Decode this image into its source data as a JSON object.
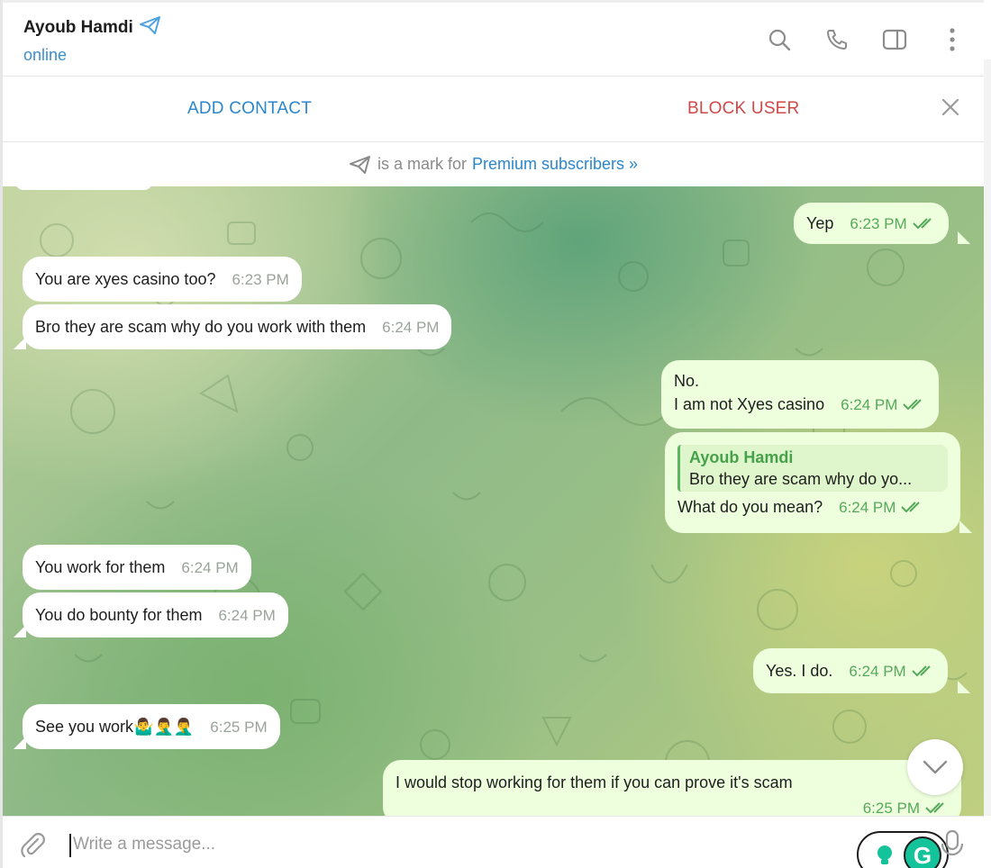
{
  "header": {
    "contact_name": "Ayoub Hamdi",
    "status": "online"
  },
  "contact_bar": {
    "add_label": "ADD CONTACT",
    "block_label": "BLOCK USER"
  },
  "premium": {
    "text": "is a mark for",
    "link": "Premium subscribers »"
  },
  "messages": [
    {
      "direction": "out",
      "text": "Yep",
      "time": "6:23 PM"
    },
    {
      "direction": "in",
      "text": "You are xyes casino too?",
      "time": "6:23 PM"
    },
    {
      "direction": "in",
      "text": "Bro they are scam why do you work with them",
      "time": "6:24 PM"
    },
    {
      "direction": "out",
      "lines": [
        "No.",
        "I am not Xyes casino"
      ],
      "time": "6:24 PM"
    },
    {
      "direction": "out",
      "reply_name": "Ayoub Hamdi",
      "reply_text": "Bro they are scam why do yo...",
      "text": "What do you mean?",
      "time": "6:24 PM"
    },
    {
      "direction": "in",
      "text": "You work for them",
      "time": "6:24 PM"
    },
    {
      "direction": "in",
      "text": "You do bounty for them",
      "time": "6:24 PM"
    },
    {
      "direction": "out",
      "text": "Yes. I do.",
      "time": "6:24 PM"
    },
    {
      "direction": "in",
      "text": "See you work🤷‍♂️🤦‍♂️🤦‍♂️",
      "time": "6:25 PM"
    },
    {
      "direction": "out",
      "text": "I would stop working for them if you can prove it's scam",
      "time": "6:25 PM"
    }
  ],
  "composer": {
    "placeholder": "Write a message..."
  },
  "colors": {
    "accent": "#2b86cc",
    "danger": "#d04848",
    "outgoing_bubble": "#eeffde",
    "check": "#56a85a"
  }
}
